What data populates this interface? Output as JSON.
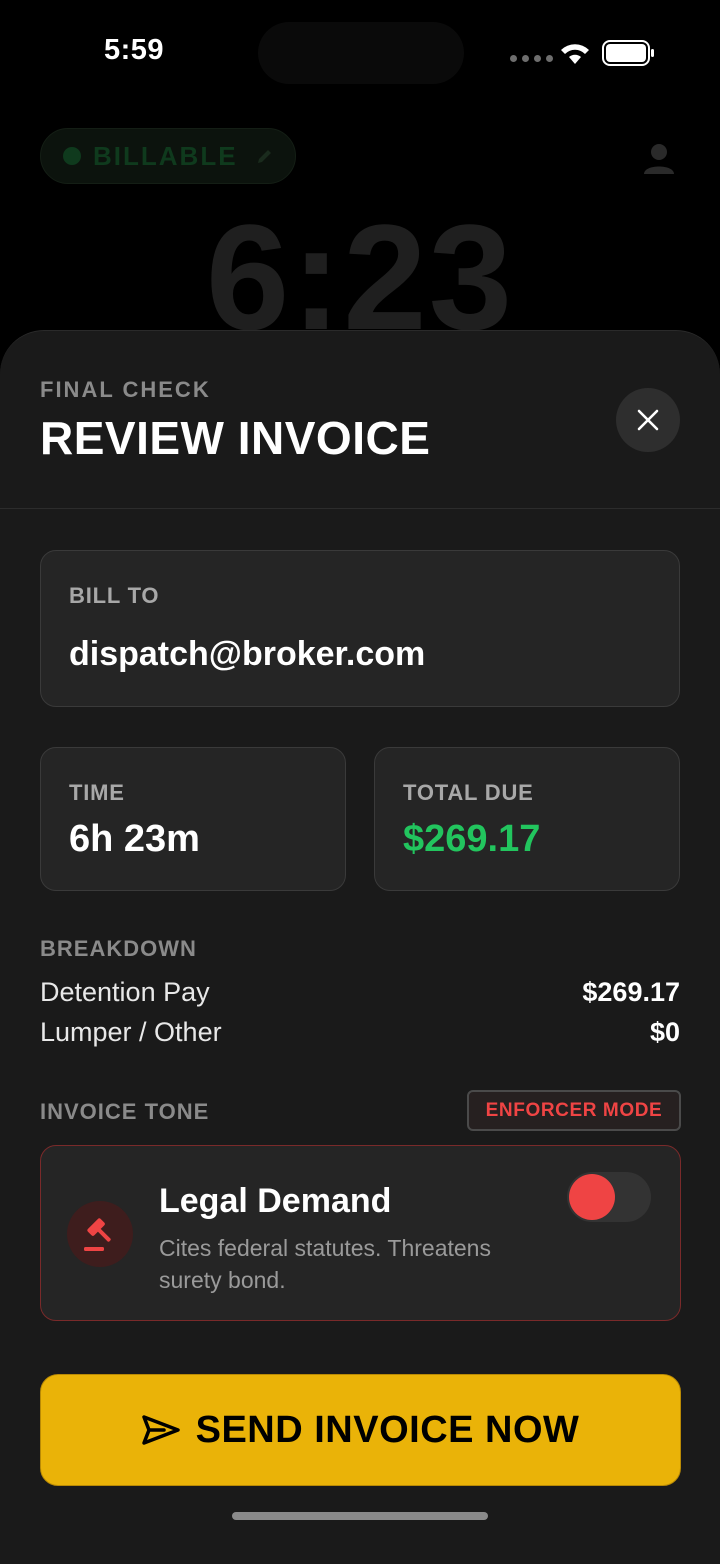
{
  "status_bar": {
    "time": "5:59"
  },
  "background": {
    "billable_label": "BILLABLE",
    "timer": "6:23"
  },
  "sheet": {
    "eyebrow": "FINAL CHECK",
    "title": "REVIEW INVOICE",
    "bill_to": {
      "label": "BILL TO",
      "value": "dispatch@broker.com"
    },
    "time": {
      "label": "TIME",
      "value": "6h 23m"
    },
    "total_due": {
      "label": "TOTAL DUE",
      "value": "$269.17"
    },
    "breakdown": {
      "label": "BREAKDOWN",
      "items": [
        {
          "name": "Detention Pay",
          "amount": "$269.17"
        },
        {
          "name": "Lumper / Other",
          "amount": "$0"
        }
      ]
    },
    "invoice_tone": {
      "label": "INVOICE TONE",
      "badge": "ENFORCER MODE",
      "option_title": "Legal Demand",
      "option_description": "Cites federal statutes. Threatens surety bond.",
      "toggle_on": true
    },
    "send_button_label": "SEND INVOICE NOW"
  },
  "colors": {
    "accent_yellow": "#eab308",
    "total_green": "#22c55e",
    "enforcer_red": "#ef4444",
    "sheet_bg": "#1a1a1a"
  },
  "icons": [
    "wifi-icon",
    "battery-icon",
    "pencil-icon",
    "profile-icon",
    "close-icon",
    "gavel-icon",
    "send-icon"
  ]
}
